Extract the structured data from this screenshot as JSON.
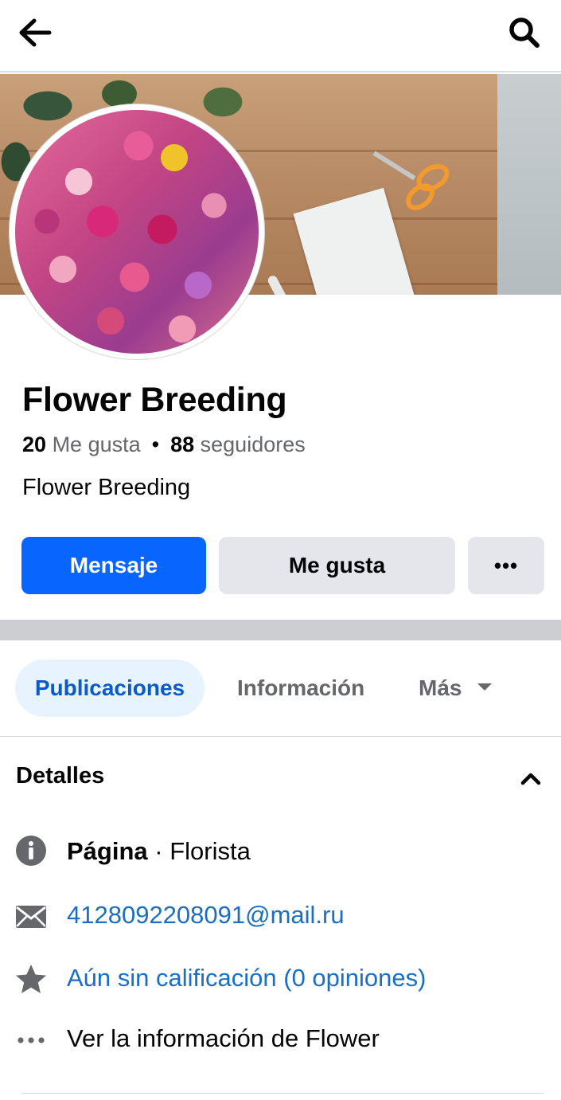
{
  "header": {
    "back_icon": "arrow-left-icon",
    "search_icon": "search-icon"
  },
  "profile": {
    "name": "Flower Breeding",
    "likes_count": "20",
    "likes_label": "Me gusta",
    "separator": "•",
    "followers_count": "88",
    "followers_label": "seguidores",
    "category": "Flower Breeding"
  },
  "actions": {
    "message_label": "Mensaje",
    "like_label": "Me gusta",
    "more_label": "•••"
  },
  "tabs": [
    {
      "label": "Publicaciones",
      "active": true
    },
    {
      "label": "Información",
      "active": false
    },
    {
      "label": "Más",
      "active": false
    }
  ],
  "details": {
    "title": "Detalles",
    "page_type_label": "Página",
    "page_type_value": " · Florista",
    "email": "4128092208091@mail.ru",
    "rating": "Aún sin calificación (0 opiniones)",
    "see_more": "Ver la información de Flower"
  },
  "colors": {
    "primary": "#0866ff",
    "link": "#1b6ec2",
    "tab_active_bg": "#e7f3ff",
    "tab_active_text": "#0a5ac8",
    "secondary_button": "#e4e6eb",
    "muted_text": "#65676b"
  }
}
